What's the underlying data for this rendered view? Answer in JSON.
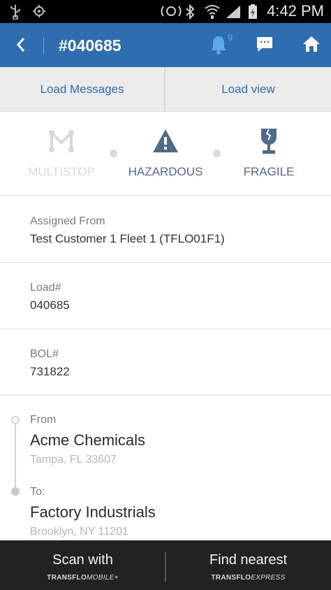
{
  "status_bar": {
    "time": "4:42 PM"
  },
  "header": {
    "title": "#040685",
    "notification_count": "9"
  },
  "tabs": [
    {
      "label": "Load Messages"
    },
    {
      "label": "Load view"
    }
  ],
  "flags": [
    {
      "label": "MULTISTOP",
      "active": false,
      "color": "#d5d9de"
    },
    {
      "label": "HAZARDOUS",
      "active": true,
      "color": "#4f6b8a"
    },
    {
      "label": "FRAGILE",
      "active": true,
      "color": "#4f6b8a"
    }
  ],
  "fields": {
    "assigned_from": {
      "label": "Assigned From",
      "value": "Test Customer 1 Fleet 1 (TFLO01F1)"
    },
    "load": {
      "label": "Load#",
      "value": "040685"
    },
    "bol": {
      "label": "BOL#",
      "value": "731822"
    }
  },
  "route": {
    "from": {
      "label": "From",
      "name": "Acme Chemicals",
      "address": "Tampa, FL 33607"
    },
    "to": {
      "label": "To:",
      "name": "Factory Industrials",
      "address": "Brooklyn, NY 11201"
    }
  },
  "bottom_bar": {
    "scan": {
      "label": "Scan with",
      "brand_bold": "TRANSFLO",
      "brand_rest": "MOBILE+"
    },
    "find": {
      "label": "Find nearest",
      "brand_bold": "TRANSFLO",
      "brand_rest": "EXPRESS"
    }
  },
  "colors": {
    "primary": "#2e6db0",
    "flag_active": "#4f6b8a",
    "flag_inactive": "#d5d9de"
  }
}
